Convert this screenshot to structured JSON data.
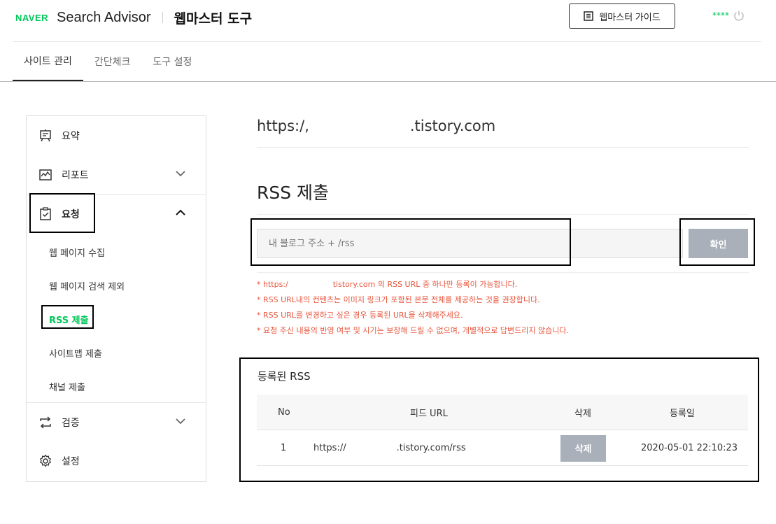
{
  "header": {
    "naver_logo": "NAVER",
    "app_title": "Search Advisor",
    "section_title": "웹마스터 도구",
    "guide_button": "웹마스터 가이드",
    "user_masked": "****"
  },
  "nav": {
    "tabs": [
      {
        "label": "사이트 관리",
        "active": true
      },
      {
        "label": "간단체크",
        "active": false
      },
      {
        "label": "도구 설정",
        "active": false
      }
    ]
  },
  "sidebar": {
    "summary": "요약",
    "report": "리포트",
    "request": "요청",
    "sub_items": [
      "웹 페이지 수집",
      "웹 페이지 검색 제외",
      "RSS 제출",
      "사이트맵 제출",
      "채널 제출"
    ],
    "verify": "검증",
    "settings": "설정"
  },
  "main": {
    "site_url_prefix": "https:/,",
    "site_url_suffix": ".tistory.com",
    "section_title": "RSS 제출",
    "input_placeholder": "내 블로그 주소 + /rss",
    "confirm_button": "확인",
    "notes": {
      "n1_prefix": "* https:/",
      "n1_suffix": "tistory.com 의 RSS URL 중 하나만 등록이 가능합니다.",
      "n2": "* RSS URL내의 컨텐츠는 이미지 링크가 포함된 본문 전체를 제공하는 것을 권장합니다.",
      "n3": "* RSS URL를 변경하고 싶은 경우 등록된 URL을 삭제해주세요.",
      "n4": "* 요청 주신 내용의 반영 여부 및 시기는 보장해 드릴 수 없으며, 개별적으로 답변드리지 않습니다."
    },
    "registered": {
      "title": "등록된 RSS",
      "headers": {
        "no": "No",
        "feed_url": "피드 URL",
        "delete": "삭제",
        "date": "등록일"
      },
      "rows": [
        {
          "no": "1",
          "url_prefix": "https://",
          "url_suffix": ".tistory.com/rss",
          "delete_label": "삭제",
          "date": "2020-05-01 22:10:23"
        }
      ]
    }
  },
  "colors": {
    "brand_green": "#03c75a",
    "note_red": "#e8553c",
    "button_gray": "#a9b0ba"
  }
}
